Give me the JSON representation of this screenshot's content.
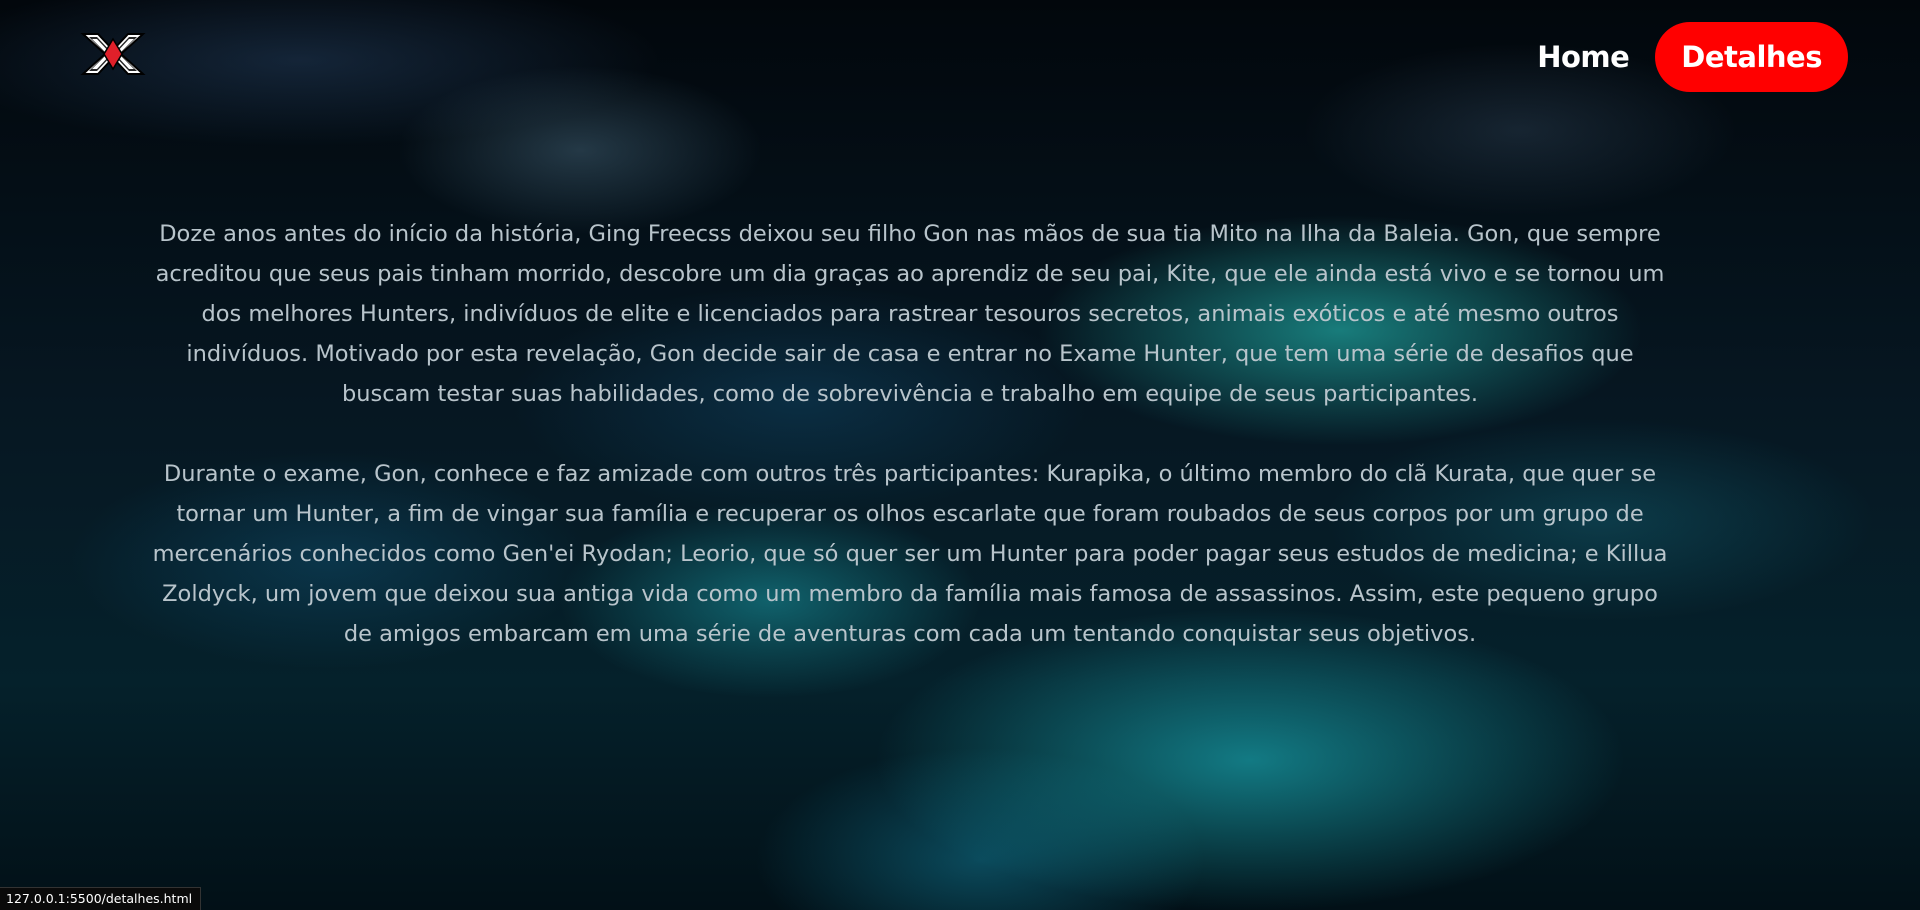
{
  "header": {
    "logo_icon": "hunter-x-hunter-logo-icon",
    "nav": {
      "home_label": "Home",
      "detalhes_label": "Detalhes"
    },
    "colors": {
      "active_button": "#ff0000",
      "logo_red": "#e0202a"
    }
  },
  "main": {
    "paragraphs": [
      "Doze anos antes do início da história, Ging Freecss deixou seu filho Gon nas mãos de sua tia Mito na Ilha da Baleia. Gon, que sempre acreditou que seus pais tinham morrido, descobre um dia graças ao aprendiz de seu pai, Kite, que ele ainda está vivo e se tornou um dos melhores Hunters, indivíduos de elite e licenciados para rastrear tesouros secretos, animais exóticos e até mesmo outros indivíduos. Motivado por esta revelação, Gon decide sair de casa e entrar no Exame Hunter, que tem uma série de desafios que buscam testar suas habilidades, como de sobrevivência e trabalho em equipe de seus participantes.",
      "Durante o exame, Gon, conhece e faz amizade com outros três participantes: Kurapika, o último membro do clã Kurata, que quer se tornar um Hunter, a fim de vingar sua família e recuperar os olhos escarlate que foram roubados de seus corpos por um grupo de mercenários conhecidos como Gen'ei Ryodan; Leorio, que só quer ser um Hunter para poder pagar seus estudos de medicina; e Killua Zoldyck, um jovem que deixou sua antiga vida como um membro da família mais famosa de assassinos. Assim, este pequeno grupo de amigos embarcam em uma série de aventuras com cada um tentando conquistar seus objetivos."
    ]
  },
  "status_bar": {
    "url": "127.0.0.1:5500/detalhes.html"
  }
}
